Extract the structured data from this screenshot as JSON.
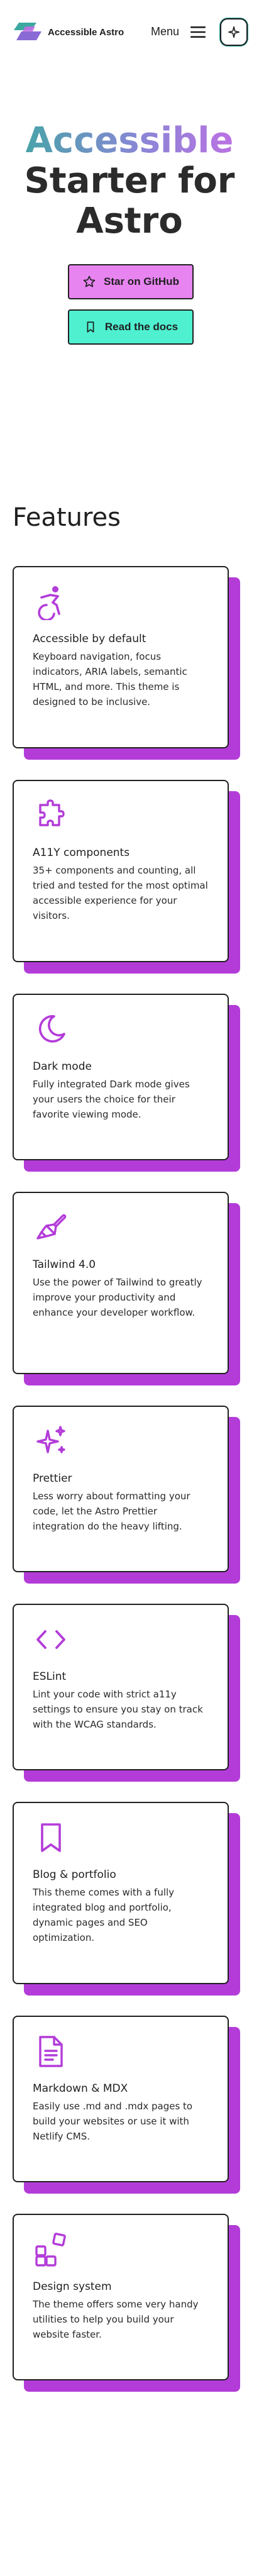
{
  "header": {
    "brand": "Accessible Astro",
    "menu_label": "Menu"
  },
  "hero": {
    "title_accent": "Accessible",
    "title_line2": "Starter for",
    "title_line3": "Astro",
    "github_button": "Star on GitHub",
    "docs_button": "Read the docs"
  },
  "features": {
    "title": "Features",
    "items": [
      {
        "icon": "accessibility-icon",
        "title": "Accessible by default",
        "text": "Keyboard navigation, focus indicators, ARIA labels, semantic HTML, and more. This theme is designed to be inclusive."
      },
      {
        "icon": "puzzle-icon",
        "title": "A11Y components",
        "text": "35+ components and counting, all tried and tested for the most optimal accessible experience for your visitors."
      },
      {
        "icon": "moon-icon",
        "title": "Dark mode",
        "text": "Fully integrated Dark mode gives your users the choice for their favorite viewing mode."
      },
      {
        "icon": "paintbrush-icon",
        "title": "Tailwind 4.0",
        "text": "Use the power of Tailwind to greatly improve your productivity and enhance your developer workflow."
      },
      {
        "icon": "sparkles-icon",
        "title": "Prettier",
        "text": "Less worry about formatting your code, let the Astro Prettier integration do the heavy lifting."
      },
      {
        "icon": "code-icon",
        "title": "ESLint",
        "text": "Lint your code with strict a11y settings to ensure you stay on track with the WCAG standards."
      },
      {
        "icon": "bookmark-icon",
        "title": "Blog & portfolio",
        "text": "This theme comes with a fully integrated blog and portfolio, dynamic pages and SEO optimization."
      },
      {
        "icon": "document-icon",
        "title": "Markdown & MDX",
        "text": "Easily use .md and .mdx pages to build your websites or use it with Netlify CMS."
      },
      {
        "icon": "blocks-icon",
        "title": "Design system",
        "text": "The theme offers some very handy utilities to help you build your website faster."
      }
    ]
  },
  "colors": {
    "accent_purple": "#b33cd9",
    "button_pink": "#e884f0",
    "button_teal": "#4ef0d0",
    "gradient_start": "#3ba9a0",
    "gradient_end": "#c86ce6"
  }
}
